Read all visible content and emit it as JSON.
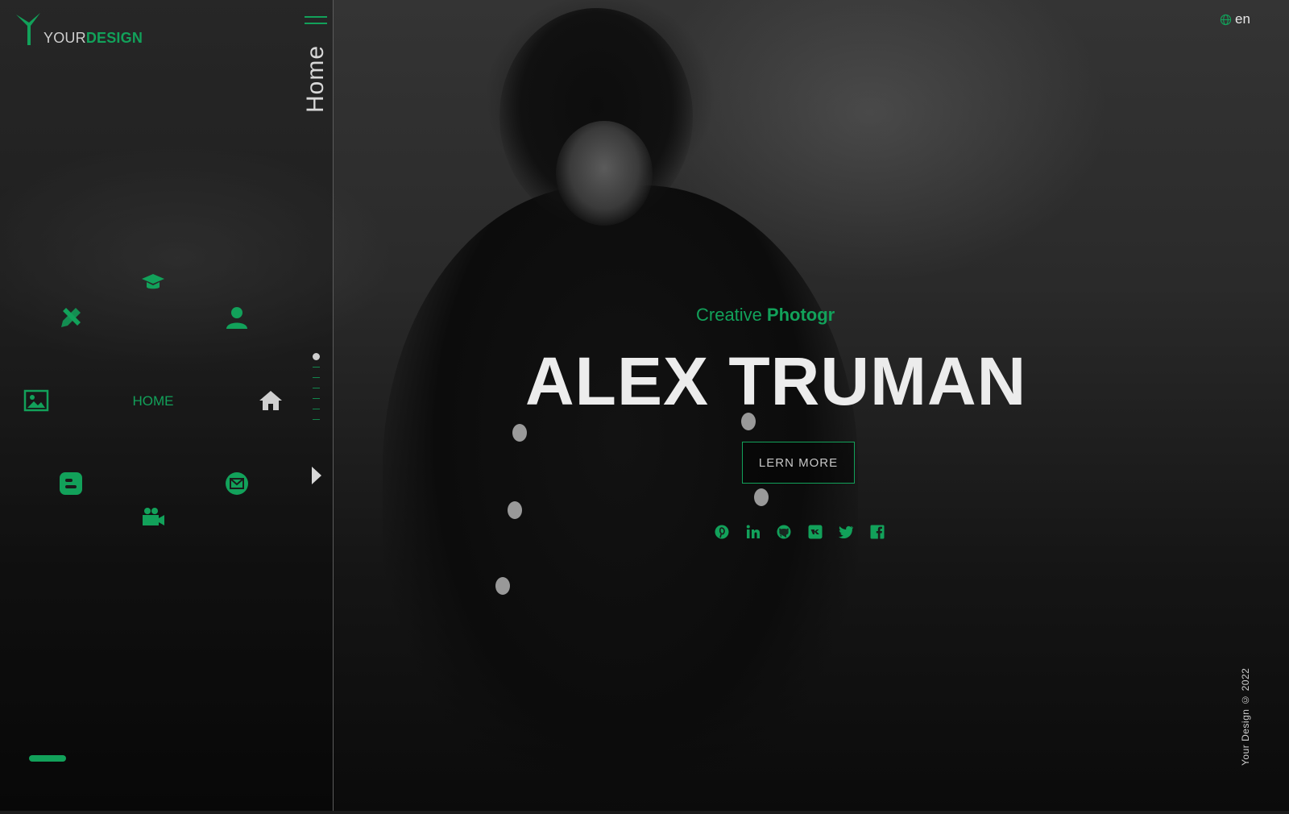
{
  "brand": {
    "logo_your": "YOUR",
    "logo_design": "DESIGN"
  },
  "sidebar": {
    "page_label": "Home",
    "home_label": "HOME",
    "nav_icons": [
      "graduation-cap-icon",
      "tools-icon",
      "user-icon",
      "image-icon",
      "home-icon",
      "blogger-icon",
      "mail-icon",
      "video-camera-icon"
    ]
  },
  "header": {
    "language": "en"
  },
  "hero": {
    "subtitle_light": "Creative",
    "subtitle_bold": "Photogr",
    "name": "ALEX TRUMAN",
    "cta_label": "LERN MORE"
  },
  "socials": [
    "pinterest-icon",
    "linkedin-icon",
    "github-icon",
    "vk-icon",
    "twitter-icon",
    "facebook-icon"
  ],
  "footer": {
    "copyright": "Your Design © 2022"
  },
  "colors": {
    "accent": "#12a15a",
    "text": "#e8e8e8",
    "muted": "#cfcfcf"
  }
}
